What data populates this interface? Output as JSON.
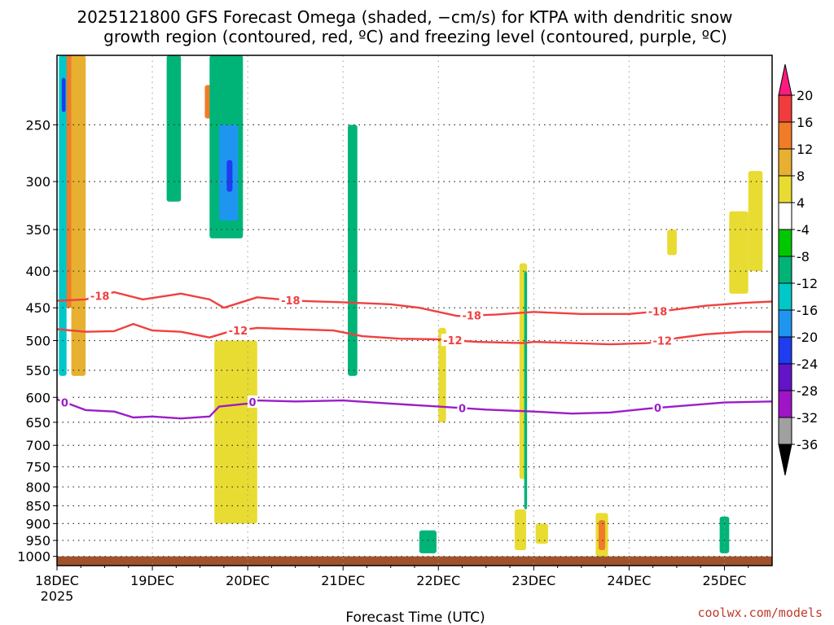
{
  "title_line1": "2025121800 GFS Forecast Omega (shaded, −cm/s) for KTPA with dendritic snow",
  "title_line2": "growth region (contoured, red, ºC) and freezing level (contoured, purple, ºC)",
  "credit": "coolwx.com/models",
  "chart_data": {
    "type": "heatmap",
    "xlabel": "Forecast Time (UTC)",
    "x_ticks": [
      "18DEC",
      "19DEC",
      "20DEC",
      "21DEC",
      "22DEC",
      "23DEC",
      "24DEC",
      "25DEC"
    ],
    "x_year": "2025",
    "xlim_days": [
      0,
      7.5
    ],
    "y_ticks": [
      "250",
      "300",
      "350",
      "400",
      "450",
      "500",
      "550",
      "600",
      "650",
      "700",
      "750",
      "800",
      "850",
      "900",
      "950",
      "1000"
    ],
    "ylim_hpa": [
      200,
      1030
    ],
    "y_scale": "log",
    "grid": "dotted",
    "colorbar": {
      "labels": [
        "20",
        "16",
        "12",
        "8",
        "4",
        "-4",
        "-8",
        "-12",
        "-16",
        "-20",
        "-24",
        "-28",
        "-32",
        "-36"
      ],
      "colors": [
        "#ff1a7f",
        "#f03c3c",
        "#f07c28",
        "#e8b030",
        "#e8dc32",
        "#ffffff",
        "#00c800",
        "#00b478",
        "#00c8c8",
        "#1e96f0",
        "#1e3cf0",
        "#6414c8",
        "#a014c8",
        "#a0a0a0",
        "#000000"
      ]
    },
    "contours": [
      {
        "label": "-18",
        "color": "#f04040",
        "points": [
          [
            0,
            440
          ],
          [
            0.3,
            438
          ],
          [
            0.6,
            428
          ],
          [
            0.9,
            438
          ],
          [
            1.3,
            430
          ],
          [
            1.6,
            438
          ],
          [
            1.75,
            450
          ],
          [
            2.1,
            435
          ],
          [
            2.5,
            440
          ],
          [
            3.0,
            442
          ],
          [
            3.5,
            445
          ],
          [
            3.8,
            450
          ],
          [
            4.2,
            462
          ],
          [
            4.6,
            460
          ],
          [
            5.0,
            456
          ],
          [
            5.5,
            459
          ],
          [
            6.0,
            459
          ],
          [
            6.4,
            454
          ],
          [
            6.8,
            447
          ],
          [
            7.2,
            443
          ],
          [
            7.5,
            441
          ]
        ],
        "label_x": [
          0.45,
          2.45,
          4.35,
          6.3
        ]
      },
      {
        "label": "-12",
        "color": "#f04040",
        "points": [
          [
            0,
            482
          ],
          [
            0.3,
            486
          ],
          [
            0.6,
            485
          ],
          [
            0.8,
            474
          ],
          [
            1.0,
            484
          ],
          [
            1.3,
            486
          ],
          [
            1.6,
            495
          ],
          [
            1.8,
            486
          ],
          [
            2.1,
            480
          ],
          [
            2.5,
            482
          ],
          [
            2.9,
            484
          ],
          [
            3.2,
            493
          ],
          [
            3.6,
            497
          ],
          [
            4.0,
            498
          ],
          [
            4.4,
            502
          ],
          [
            4.9,
            504
          ],
          [
            5.0,
            502
          ],
          [
            5.4,
            504
          ],
          [
            5.8,
            506
          ],
          [
            6.2,
            504
          ],
          [
            6.5,
            496
          ],
          [
            6.8,
            490
          ],
          [
            7.2,
            486
          ],
          [
            7.5,
            486
          ]
        ],
        "label_x": [
          1.9,
          4.15,
          6.35
        ]
      },
      {
        "label": "0",
        "color": "#9b1dc8",
        "points": [
          [
            0,
            604
          ],
          [
            0.3,
            625
          ],
          [
            0.6,
            628
          ],
          [
            0.8,
            640
          ],
          [
            1.0,
            638
          ],
          [
            1.3,
            642
          ],
          [
            1.6,
            638
          ],
          [
            1.7,
            618
          ],
          [
            2.0,
            612
          ],
          [
            2.1,
            606
          ],
          [
            2.5,
            608
          ],
          [
            3.0,
            606
          ],
          [
            3.5,
            612
          ],
          [
            4.0,
            618
          ],
          [
            4.5,
            624
          ],
          [
            5.0,
            628
          ],
          [
            5.4,
            632
          ],
          [
            5.8,
            630
          ],
          [
            6.2,
            622
          ],
          [
            6.6,
            616
          ],
          [
            7.0,
            610
          ],
          [
            7.5,
            608
          ]
        ],
        "label_x": [
          0.08,
          2.05,
          4.25,
          6.3
        ]
      }
    ],
    "shaded_regions": [
      {
        "value": 12,
        "x": [
          0.08,
          0.3
        ],
        "p": [
          200,
          450
        ]
      },
      {
        "value": 8,
        "x": [
          0.15,
          0.3
        ],
        "p": [
          200,
          560
        ]
      },
      {
        "value": -12,
        "x": [
          0.02,
          0.1
        ],
        "p": [
          200,
          560
        ]
      },
      {
        "value": -20,
        "x": [
          0.05,
          0.09
        ],
        "p": [
          215,
          240
        ]
      },
      {
        "value": 12,
        "x": [
          1.55,
          1.62
        ],
        "p": [
          220,
          245
        ]
      },
      {
        "value": -8,
        "x": [
          1.6,
          1.95
        ],
        "p": [
          200,
          360
        ]
      },
      {
        "value": -16,
        "x": [
          1.7,
          1.9
        ],
        "p": [
          250,
          340
        ]
      },
      {
        "value": -20,
        "x": [
          1.78,
          1.84
        ],
        "p": [
          280,
          310
        ]
      },
      {
        "value": 4,
        "x": [
          1.65,
          2.1
        ],
        "p": [
          500,
          900
        ]
      },
      {
        "value": -8,
        "x": [
          1.15,
          1.3
        ],
        "p": [
          200,
          320
        ]
      },
      {
        "value": -8,
        "x": [
          3.05,
          3.15
        ],
        "p": [
          250,
          560
        ]
      },
      {
        "value": 4,
        "x": [
          4.0,
          4.08
        ],
        "p": [
          480,
          650
        ]
      },
      {
        "value": 4,
        "x": [
          4.85,
          4.93
        ],
        "p": [
          390,
          780
        ]
      },
      {
        "value": -8,
        "x": [
          4.9,
          4.93
        ],
        "p": [
          400,
          860
        ]
      },
      {
        "value": -8,
        "x": [
          3.8,
          3.98
        ],
        "p": [
          920,
          990
        ]
      },
      {
        "value": 4,
        "x": [
          4.8,
          4.92
        ],
        "p": [
          860,
          980
        ]
      },
      {
        "value": 4,
        "x": [
          5.02,
          5.15
        ],
        "p": [
          900,
          960
        ]
      },
      {
        "value": 4,
        "x": [
          6.4,
          6.5
        ],
        "p": [
          350,
          380
        ]
      },
      {
        "value": 4,
        "x": [
          7.05,
          7.25
        ],
        "p": [
          330,
          430
        ]
      },
      {
        "value": 4,
        "x": [
          7.25,
          7.4
        ],
        "p": [
          290,
          400
        ]
      },
      {
        "value": 4,
        "x": [
          5.65,
          5.78
        ],
        "p": [
          870,
          1000
        ]
      },
      {
        "value": 12,
        "x": [
          5.68,
          5.75
        ],
        "p": [
          890,
          980
        ]
      },
      {
        "value": -8,
        "x": [
          6.95,
          7.05
        ],
        "p": [
          880,
          990
        ]
      }
    ],
    "surface": {
      "color": "#a0522d",
      "p": [
        1000,
        1030
      ]
    }
  }
}
